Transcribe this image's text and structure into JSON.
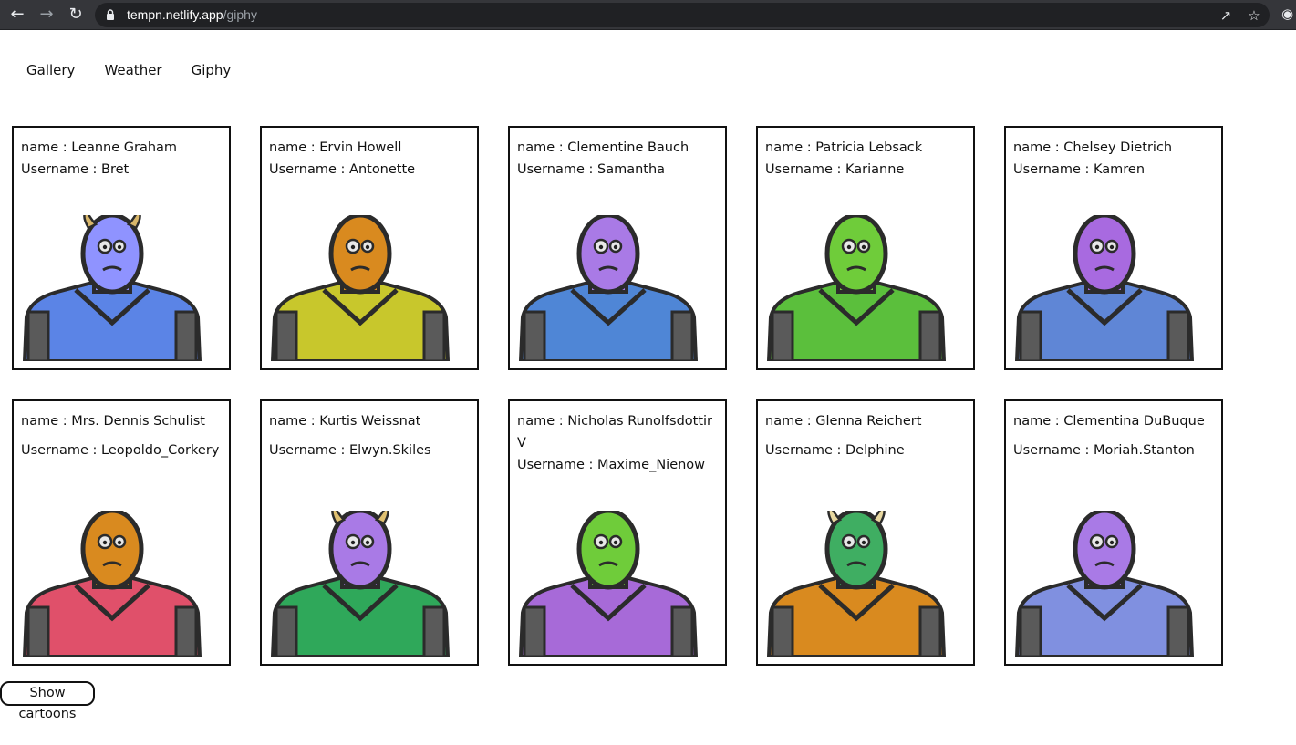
{
  "browser": {
    "url_host": "tempn.netlify.app",
    "url_path": "/giphy"
  },
  "nav": {
    "items": [
      "Gallery",
      "Weather",
      "Giphy"
    ]
  },
  "users": [
    {
      "name": "name : Leanne Graham",
      "username": "Username : Bret",
      "head": "#8f93ff",
      "body": "#5b84e6",
      "horn": "#d8b66a"
    },
    {
      "name": "name : Ervin Howell",
      "username": "Username : Antonette",
      "head": "#d98a1f",
      "body": "#c8c72c",
      "horn": ""
    },
    {
      "name": "name : Clementine Bauch",
      "username": "Username : Samantha",
      "head": "#a97ae6",
      "body": "#4f86d6",
      "horn": ""
    },
    {
      "name": "name : Patricia Lebsack",
      "username": "Username : Karianne",
      "head": "#6fcc3a",
      "body": "#5bbf3c",
      "horn": ""
    },
    {
      "name": "name : Chelsey Dietrich",
      "username": "Username : Kamren",
      "head": "#a86ae0",
      "body": "#5f86d6",
      "horn": ""
    },
    {
      "name": "name : Mrs. Dennis Schulist",
      "username": "Username : Leopoldo_Corkery",
      "head": "#d98a1f",
      "body": "#e0506a",
      "horn": ""
    },
    {
      "name": "name : Kurtis Weissnat",
      "username": "Username : Elwyn.Skiles",
      "head": "#a97ae6",
      "body": "#2fa85a",
      "horn": "#e0c070"
    },
    {
      "name": "name : Nicholas Runolfsdottir V",
      "username": "Username : Maxime_Nienow",
      "head": "#6fcc3a",
      "body": "#a76ad8",
      "horn": ""
    },
    {
      "name": "name : Glenna Reichert",
      "username": "Username : Delphine",
      "head": "#3fae62",
      "body": "#d98a1f",
      "horn": "#e8d8a0"
    },
    {
      "name": "name : Clementina DuBuque",
      "username": "Username : Moriah.Stanton",
      "head": "#a97ae6",
      "body": "#8090e0",
      "horn": ""
    }
  ],
  "button": {
    "show_label": "Show cartoons"
  }
}
